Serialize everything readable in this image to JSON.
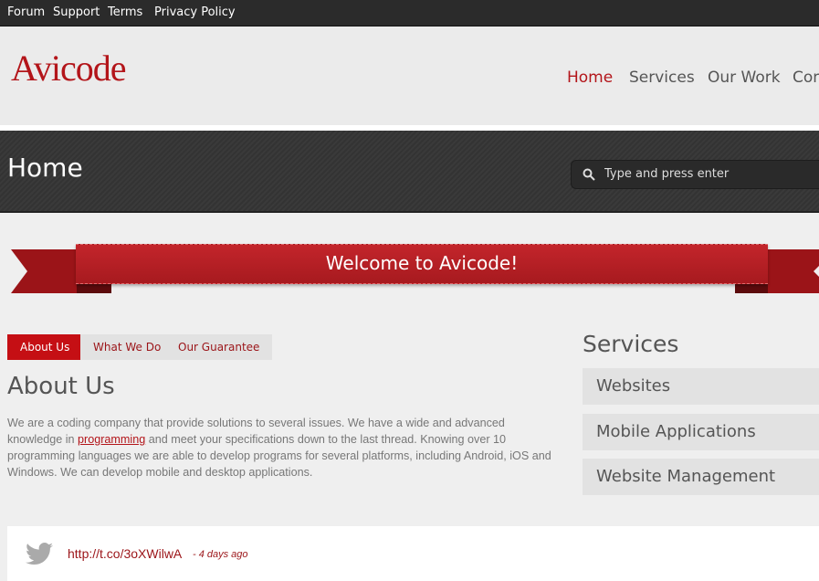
{
  "topbar": {
    "links": [
      "Forum",
      "Support",
      "Terms",
      "Privacy Policy"
    ]
  },
  "header": {
    "logo": "Avicode",
    "nav": [
      "Home",
      "Services",
      "Our Work",
      "Cont"
    ]
  },
  "page": {
    "title": "Home",
    "search_placeholder": "Type and press enter"
  },
  "ribbon": {
    "text": "Welcome to Avicode!"
  },
  "tabs": [
    "About Us",
    "What We Do",
    "Our Guarantee"
  ],
  "about": {
    "title": "About Us",
    "text_before": "We are a coding company that provide solutions to several issues. We have a wide and advanced knowledge in ",
    "link": "programming",
    "text_after": " and meet your specifications down to the last thread. Knowing over 10 programming languages we are able to develop programs for several platforms, including Android, iOS and Windows. We can develop mobile and desktop applications."
  },
  "services": {
    "title": "Services",
    "items": [
      "Websites",
      "Mobile Applications",
      "Website Management"
    ]
  },
  "tweet": {
    "link": "http://t.co/3oXWilwA",
    "time": "- 4 days ago"
  },
  "colors": {
    "accent": "#b3151a",
    "dark": "#2b2b2b"
  }
}
